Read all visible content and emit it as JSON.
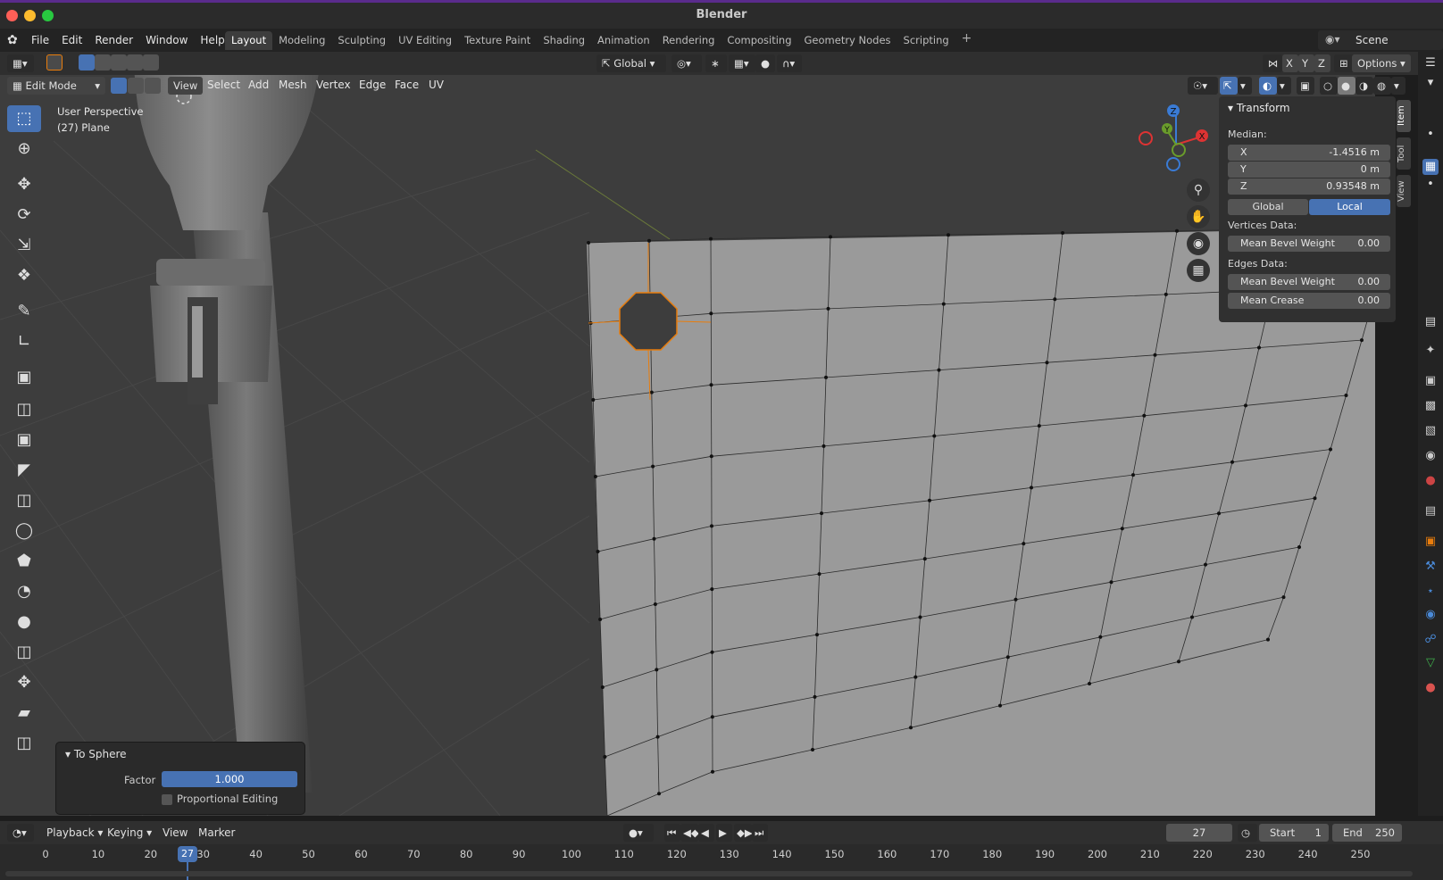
{
  "app": {
    "title": "Blender"
  },
  "menu": [
    "File",
    "Edit",
    "Render",
    "Window",
    "Help"
  ],
  "workspaces": [
    "Layout",
    "Modeling",
    "Sculpting",
    "UV Editing",
    "Texture Paint",
    "Shading",
    "Animation",
    "Rendering",
    "Compositing",
    "Geometry Nodes",
    "Scripting"
  ],
  "scene": "Scene",
  "header": {
    "orientation": "Global",
    "axes": [
      "X",
      "Y",
      "Z"
    ],
    "options": "Options",
    "mode": "Edit Mode",
    "menus": [
      "View",
      "Select",
      "Add",
      "Mesh",
      "Vertex",
      "Edge",
      "Face",
      "UV"
    ]
  },
  "viewport": {
    "perspective": "User Perspective",
    "object": "(27) Plane"
  },
  "gizmo": {
    "x": "X",
    "y": "Y",
    "z": "Z"
  },
  "npanel": {
    "tabs": [
      "Item",
      "Tool",
      "View"
    ],
    "transform": {
      "title": "Transform",
      "median_label": "Median:",
      "x": {
        "label": "X",
        "value": "-1.4516 m"
      },
      "y": {
        "label": "Y",
        "value": "0 m"
      },
      "z": {
        "label": "Z",
        "value": "0.93548 m"
      },
      "global": "Global",
      "local": "Local",
      "vertices_label": "Vertices Data:",
      "v_bevel": {
        "label": "Mean Bevel Weight",
        "value": "0.00"
      },
      "edges_label": "Edges Data:",
      "e_bevel": {
        "label": "Mean Bevel Weight",
        "value": "0.00"
      },
      "e_crease": {
        "label": "Mean Crease",
        "value": "0.00"
      }
    }
  },
  "operator": {
    "title": "To Sphere",
    "factor_label": "Factor",
    "factor_value": "1.000",
    "prop_label": "Proportional Editing"
  },
  "timeline": {
    "menus": [
      "Playback",
      "Keying",
      "View",
      "Marker"
    ],
    "current_frame": "27",
    "start_label": "Start",
    "start": "1",
    "end_label": "End",
    "end": "250",
    "ticks": [
      "0",
      "10",
      "20",
      "30",
      "40",
      "50",
      "60",
      "70",
      "80",
      "90",
      "100",
      "110",
      "120",
      "130",
      "140",
      "150",
      "160",
      "170",
      "180",
      "190",
      "200",
      "210",
      "220",
      "230",
      "240",
      "250"
    ]
  },
  "colors": {
    "accent": "#4772b3",
    "selected": "#e87d0d"
  }
}
